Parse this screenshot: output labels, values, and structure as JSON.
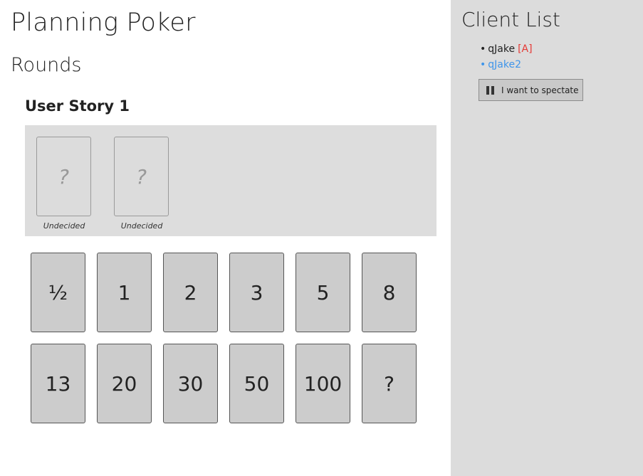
{
  "app": {
    "title": "Planning Poker",
    "rounds_heading": "Rounds"
  },
  "round": {
    "story_title": "User Story 1",
    "votes": [
      {
        "card": "?",
        "label": "Undecided"
      },
      {
        "card": "?",
        "label": "Undecided"
      }
    ]
  },
  "deck": {
    "cards": [
      "½",
      "1",
      "2",
      "3",
      "5",
      "8",
      "13",
      "20",
      "30",
      "50",
      "100",
      "?"
    ]
  },
  "sidebar": {
    "title": "Client List",
    "clients": [
      {
        "bullet": "•",
        "name": "qJake",
        "badge": "[A]",
        "color": "#222222",
        "badge_color": "#e53935"
      },
      {
        "bullet": "•",
        "name": "qJake2",
        "badge": "",
        "color": "#3f95ea",
        "badge_color": ""
      }
    ],
    "spectate_button": {
      "label": "I want to spectate",
      "icon": "pause-icon"
    }
  },
  "colors": {
    "sidebar_bg": "#dcdcdc",
    "panel_bg": "#dddddd",
    "card_bg": "#cccccc",
    "admin_badge": "#e53935",
    "self_link": "#3f95ea"
  }
}
